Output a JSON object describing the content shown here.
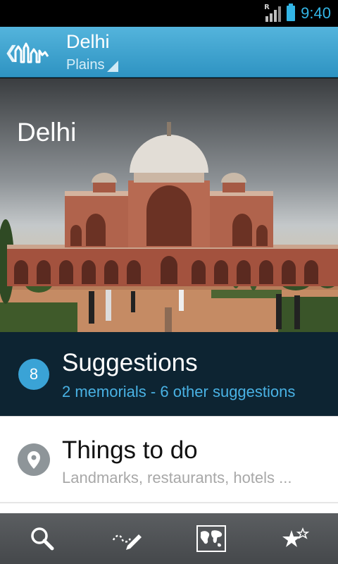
{
  "status_bar": {
    "time": "9:40",
    "roaming_indicator": "R",
    "icons": [
      "signal-icon",
      "battery-icon"
    ]
  },
  "action_bar": {
    "title": "Delhi",
    "subtitle": "Plains",
    "logo_icon": "skyline-logo-icon",
    "accent_color": "#33b5e5"
  },
  "hero": {
    "title": "Delhi",
    "image": "humayuns-tomb-photo"
  },
  "suggestions": {
    "count": "8",
    "title": "Suggestions",
    "subtitle": "2 memorials - 6 other suggestions"
  },
  "things_to_do": {
    "title": "Things to do",
    "subtitle": "Landmarks, restaurants, hotels ...",
    "icon": "map-pin-icon"
  },
  "bottom_bar": {
    "tabs": [
      {
        "icon": "search-icon"
      },
      {
        "icon": "pen-trail-icon"
      },
      {
        "icon": "world-map-icon",
        "selected": true
      },
      {
        "icon": "favorite-stars-icon"
      }
    ]
  }
}
